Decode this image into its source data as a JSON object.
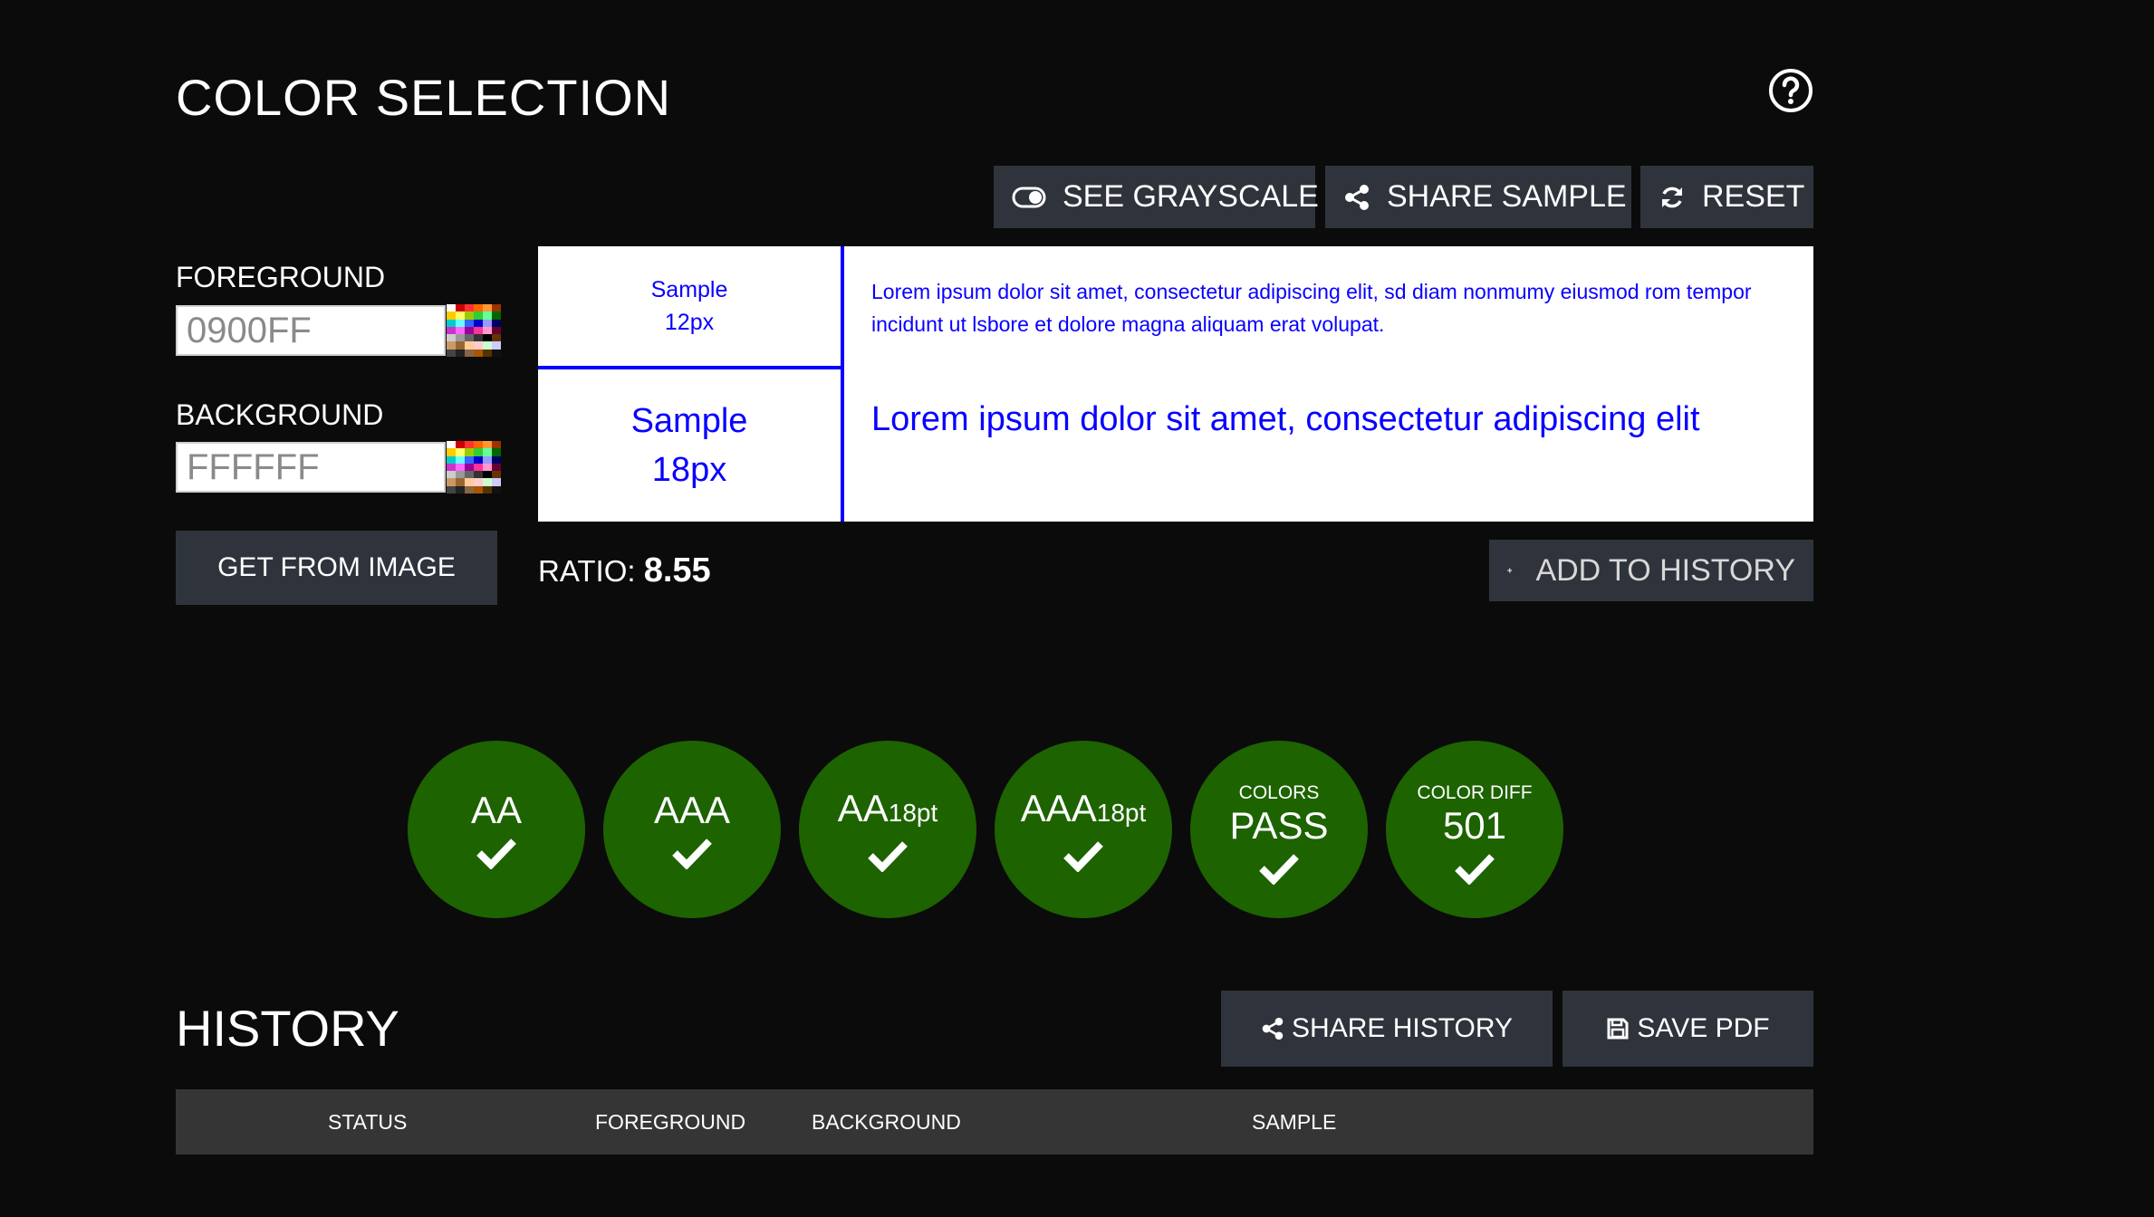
{
  "header": {
    "title": "COLOR SELECTION",
    "help_icon": "help-circle-icon"
  },
  "toolbar": {
    "grayscale_label": "SEE GRAYSCALE",
    "share_sample_label": "SHARE SAMPLE",
    "reset_label": "RESET"
  },
  "foreground": {
    "label": "FOREGROUND",
    "value": "0900FF",
    "color": "#0900FF"
  },
  "background": {
    "label": "BACKGROUND",
    "value": "FFFFFF",
    "color": "#FFFFFF"
  },
  "get_from_image_label": "GET FROM IMAGE",
  "sample": {
    "small_title": "Sample",
    "small_size": "12px",
    "small_text": "Lorem ipsum dolor sit amet, consectetur adipiscing elit, sd diam nonmumy eiusmod rom tempor incidunt ut lsbore et dolore magna aliquam erat volupat.",
    "large_title": "Sample",
    "large_size": "18px",
    "large_text": "Lorem ipsum dolor sit amet, consectetur adipiscing elit"
  },
  "ratio": {
    "label": "RATIO:",
    "value": "8.55"
  },
  "add_to_history_label": "ADD TO HISTORY",
  "results": [
    {
      "caption": "",
      "main": "AA",
      "sub": "",
      "status": "pass"
    },
    {
      "caption": "",
      "main": "AAA",
      "sub": "",
      "status": "pass"
    },
    {
      "caption": "",
      "main": "AA",
      "sub": "18pt",
      "status": "pass"
    },
    {
      "caption": "",
      "main": "AAA",
      "sub": "18pt",
      "status": "pass"
    },
    {
      "caption": "COLORS",
      "main": "PASS",
      "sub": "",
      "status": "pass"
    },
    {
      "caption": "COLOR DIFF",
      "main": "501",
      "sub": "",
      "status": "pass"
    }
  ],
  "colors": {
    "pass_green": "#1D6300",
    "button_bg": "#2F343C",
    "page_bg": "#0B0B0B"
  },
  "history": {
    "title": "HISTORY",
    "share_label": "SHARE HISTORY",
    "save_pdf_label": "SAVE PDF",
    "columns": [
      "STATUS",
      "FOREGROUND",
      "BACKGROUND",
      "SAMPLE"
    ]
  }
}
